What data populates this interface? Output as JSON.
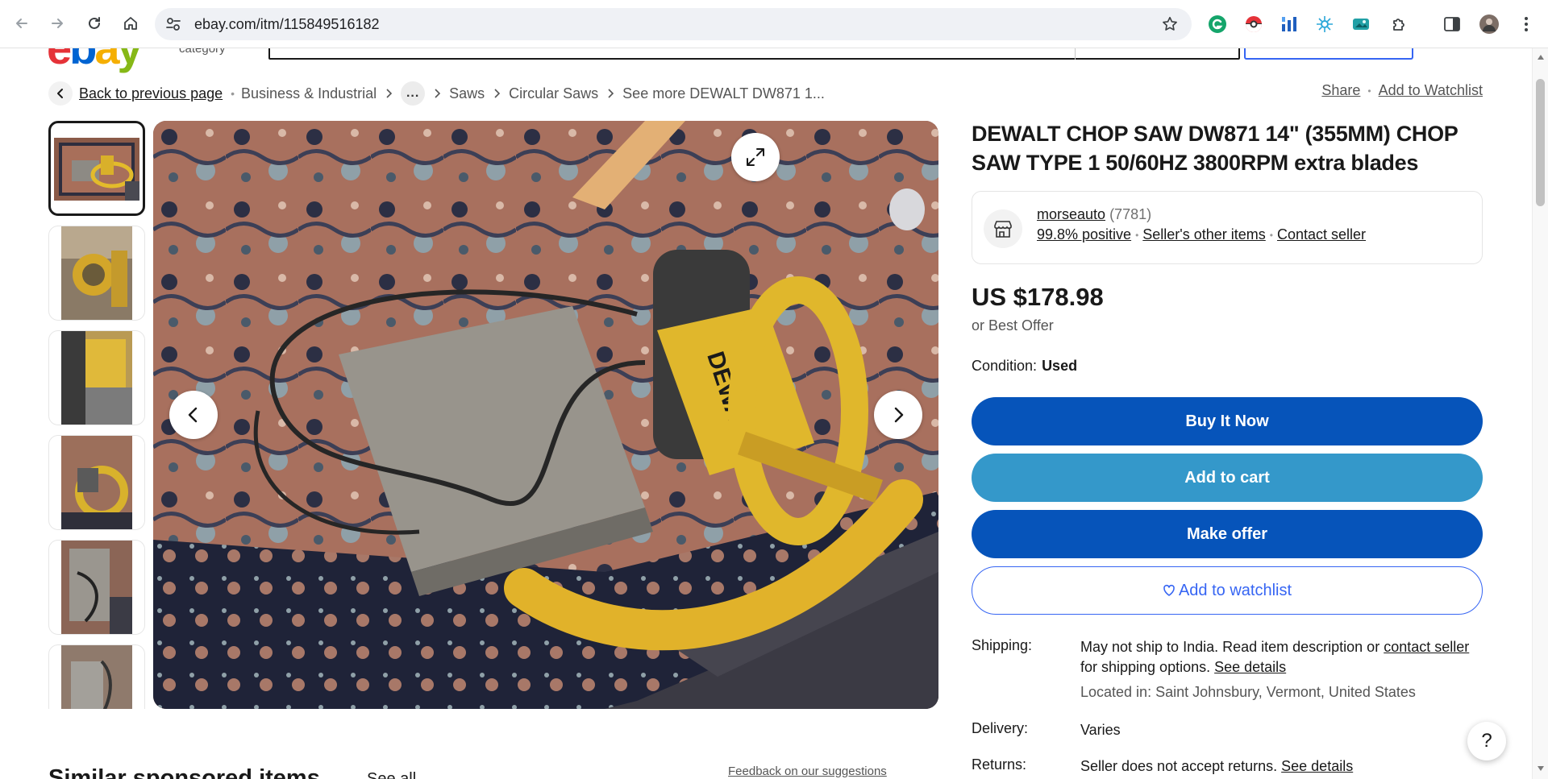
{
  "browser": {
    "url": "ebay.com/itm/115849516182",
    "icons": [
      "back-icon",
      "forward-icon",
      "reload-icon",
      "home-icon",
      "site-info-icon",
      "bookmark-star-icon"
    ],
    "extensions": [
      "grammarly-icon",
      "pokeball-extension-icon",
      "dashboard-extension-icon",
      "ai-extension-icon",
      "photo-extension-icon",
      "extensions-puzzle-icon",
      "side-panel-icon",
      "profile-avatar",
      "menu-kebab-icon"
    ]
  },
  "header": {
    "logo_letters": [
      "e",
      "b",
      "a",
      "y"
    ],
    "category_hint": "category"
  },
  "breadcrumbs": {
    "back_label": "Back to previous page",
    "items": [
      "Business & Industrial",
      "Saws",
      "Circular Saws",
      "See more DEWALT DW871 1..."
    ],
    "more_label": "..."
  },
  "top_actions": {
    "share": "Share",
    "watchlist": "Add to Watchlist"
  },
  "item": {
    "title": "DEWALT CHOP SAW DW871 14\" (355MM) CHOP SAW TYPE 1 50/60HZ 3800RPM extra blades",
    "price": "US $178.98",
    "best_offer": "or Best Offer",
    "condition_label": "Condition:",
    "condition_value": "Used",
    "thumbnail_count": 6
  },
  "seller": {
    "name": "morseauto",
    "feedback_count": "(7781)",
    "positive": "99.8% positive",
    "other_items": "Seller's other items",
    "contact": "Contact seller"
  },
  "buttons": {
    "buy_now": "Buy It Now",
    "add_to_cart": "Add to cart",
    "make_offer": "Make offer",
    "add_watchlist": "Add to watchlist"
  },
  "shipping": {
    "label": "Shipping:",
    "text1": "May not ship to India. Read item description or ",
    "contact_link": "contact seller",
    "text2": " for shipping options. ",
    "details_link": "See details",
    "located": "Located in: Saint Johnsbury, Vermont, United States"
  },
  "delivery": {
    "label": "Delivery:",
    "value": "Varies"
  },
  "returns": {
    "label": "Returns:",
    "value": "Seller does not accept returns. ",
    "details_link": "See details"
  },
  "help": {
    "label": "?"
  },
  "similar": {
    "heading": "Similar sponsored items",
    "see_all": "See all",
    "feedback": "Feedback on our suggestions"
  },
  "colors": {
    "primary_blue": "#0654ba",
    "cart_blue": "#3498ca",
    "link_blue": "#3665f3",
    "ebay_red": "#e53238",
    "ebay_blue": "#0064d2",
    "ebay_yellow": "#f5af02",
    "ebay_green": "#86b817"
  }
}
